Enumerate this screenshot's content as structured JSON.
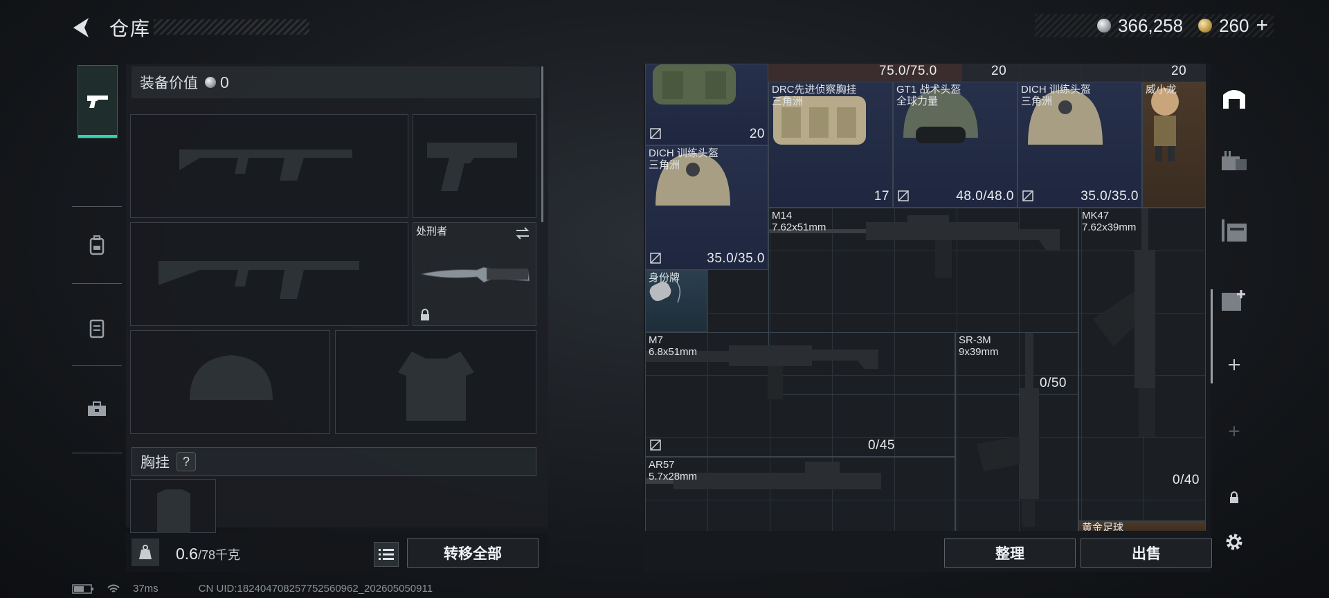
{
  "header": {
    "title": "仓库"
  },
  "currency": {
    "silver": "366,258",
    "gold": "260",
    "gold_plus": "+"
  },
  "left_nav": {
    "items": [
      "pistol",
      "backpack",
      "chest-rig",
      "toolbox"
    ]
  },
  "equipment": {
    "value_label": "装备价值",
    "value": "0",
    "melee": {
      "name": "处刑者"
    },
    "section_label": "胸挂",
    "section_help": "?",
    "weight_current": "0.6",
    "weight_max": "/78千克",
    "transfer_all": "转移全部"
  },
  "storage": {
    "items": [
      {
        "id": "top-strip",
        "val": "75.0/75.0",
        "right_a": "20",
        "right_b": "20"
      },
      {
        "id": "backpack-top",
        "count": "20"
      },
      {
        "id": "drc",
        "name1": "DRC先进侦察胸挂",
        "name2": "三角洲",
        "count": "17"
      },
      {
        "id": "gt1",
        "name1": "GT1 战术头盔",
        "name2": "全球力量",
        "val": "48.0/48.0"
      },
      {
        "id": "dich1",
        "name1": "DICH 训练头盔",
        "name2": "三角洲",
        "val": "35.0/35.0"
      },
      {
        "id": "figure",
        "name1": "威小龙"
      },
      {
        "id": "dich2",
        "name1": "DICH 训练头盔",
        "name2": "三角洲",
        "val": "35.0/35.0"
      },
      {
        "id": "m14",
        "name1": "M14",
        "name2": "7.62x51mm",
        "val": "0/50"
      },
      {
        "id": "mk47",
        "name1": "MK47",
        "name2": "7.62x39mm",
        "val": "0/40"
      },
      {
        "id": "idcard",
        "name1": "身份牌"
      },
      {
        "id": "m7",
        "name1": "M7",
        "name2": "6.8x51mm",
        "val": "0/45"
      },
      {
        "id": "sr3m",
        "name1": "SR-3M",
        "name2": "9x39mm"
      },
      {
        "id": "ar57",
        "name1": "AR57",
        "name2": "5.7x28mm"
      },
      {
        "id": "gold-ball",
        "name1": "黄金足球"
      }
    ],
    "sort_label": "整理",
    "sell_label": "出售"
  },
  "status": {
    "ping": "37ms",
    "uid": "CN UID:182404708257752560962_202605050911"
  }
}
